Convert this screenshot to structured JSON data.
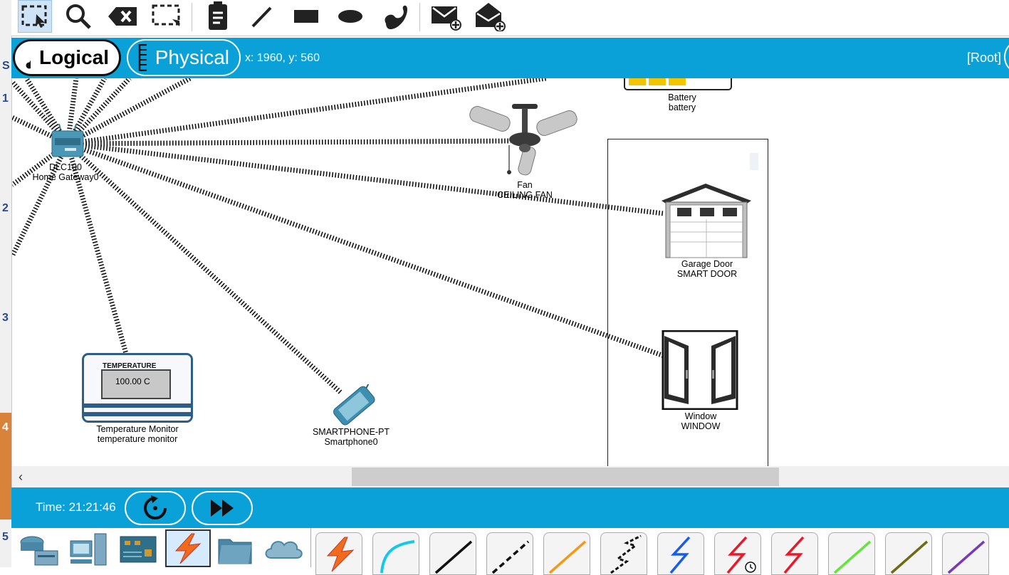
{
  "ruler": {
    "numbers": [
      "S",
      "1",
      "2",
      "3",
      "4",
      "5"
    ]
  },
  "toolbar": {
    "tools": [
      "select-tool",
      "inspect-tool",
      "delete-tool",
      "resize-shape-tool",
      "place-note-tool",
      "draw-line-tool",
      "draw-rectangle-tool",
      "draw-ellipse-tool",
      "freeform-tool",
      "add-simple-pdu-tool",
      "add-complex-pdu-tool"
    ]
  },
  "modebar": {
    "logical_label": "Logical",
    "physical_label": "Physical",
    "coords": "x: 1960, y: 560",
    "root_label": "[Root]"
  },
  "devices": {
    "gateway": {
      "line1": "DLC100",
      "line2": "Home Gateway0"
    },
    "fan": {
      "line1": "Fan",
      "line2": "CEILING FAN"
    },
    "battery": {
      "line1": "Battery",
      "line2": "battery"
    },
    "garage": {
      "line1": "Garage Door",
      "line2": "SMART DOOR"
    },
    "window": {
      "line1": "Window",
      "line2": "WINDOW"
    },
    "temp": {
      "line1": "Temperature Monitor",
      "line2": "temperature monitor",
      "screen_title": "TEMPERATURE",
      "reading": "100.00 C"
    },
    "phone": {
      "line1": "SMARTPHONE-PT",
      "line2": "Smartphone0"
    }
  },
  "sim": {
    "time": "Time: 21:21:46"
  },
  "colors": {
    "accent": "#0aa0d8",
    "toolbar_selected": "#cfe3f6"
  }
}
